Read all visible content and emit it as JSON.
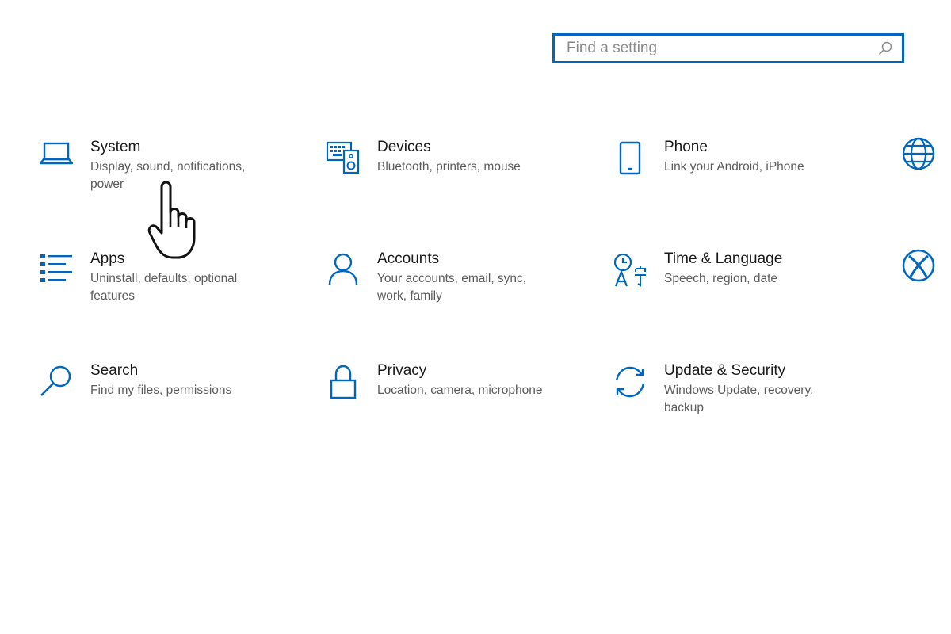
{
  "search": {
    "placeholder": "Find a setting",
    "icon": "search-icon"
  },
  "accent_color": "#0067c0",
  "tiles": [
    {
      "title": "System",
      "desc": "Display, sound, notifications, power",
      "icon": "laptop-icon"
    },
    {
      "title": "Devices",
      "desc": "Bluetooth, printers, mouse",
      "icon": "keyboard-speaker-icon"
    },
    {
      "title": "Phone",
      "desc": "Link your Android, iPhone",
      "icon": "phone-icon"
    },
    {
      "title": "Apps",
      "desc": "Uninstall, defaults, optional features",
      "icon": "apps-list-icon"
    },
    {
      "title": "Accounts",
      "desc": "Your accounts, email, sync, work, family",
      "icon": "person-icon"
    },
    {
      "title": "Time & Language",
      "desc": "Speech, region, date",
      "icon": "time-language-icon"
    },
    {
      "title": "Search",
      "desc": "Find my files, permissions",
      "icon": "magnifier-icon"
    },
    {
      "title": "Privacy",
      "desc": "Location, camera, microphone",
      "icon": "lock-icon"
    },
    {
      "title": "Update & Security",
      "desc": "Windows Update, recovery, backup",
      "icon": "sync-arrows-icon"
    }
  ],
  "partial_icons": [
    "globe-icon",
    "xbox-icon"
  ],
  "cursor": "hand-pointer-icon"
}
